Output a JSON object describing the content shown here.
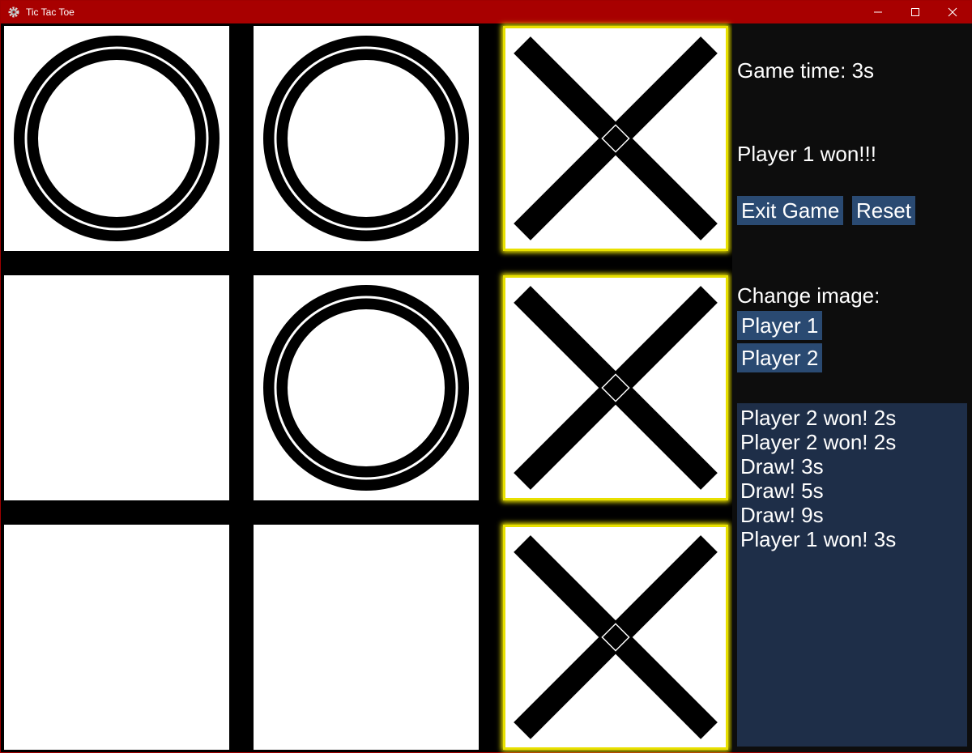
{
  "window": {
    "title": "Tic Tac Toe",
    "icon": "gear-icon",
    "controls": [
      "minimize-icon",
      "maximize-icon",
      "close-icon"
    ]
  },
  "board": {
    "cells": [
      [
        "O",
        "O",
        "X"
      ],
      [
        "",
        "O",
        "X"
      ],
      [
        "",
        "",
        "X"
      ]
    ],
    "highlight_color": "#f0e800"
  },
  "side": {
    "game_time": "Game time: 3s",
    "status": "Player 1 won!!!",
    "exit_label": "Exit Game",
    "reset_label": "Reset",
    "change_image_label": "Change image:",
    "player1_label": "Player 1",
    "player2_label": "Player 2",
    "history": [
      "Player 2 won! 2s",
      "Player 2 won! 2s",
      "Draw! 3s",
      "Draw! 5s",
      "Draw! 9s",
      "Player 1 won! 3s"
    ]
  },
  "colors": {
    "titlebar": "#a80000",
    "button": "#2a4a72",
    "history_bg": "#1e2e48"
  }
}
